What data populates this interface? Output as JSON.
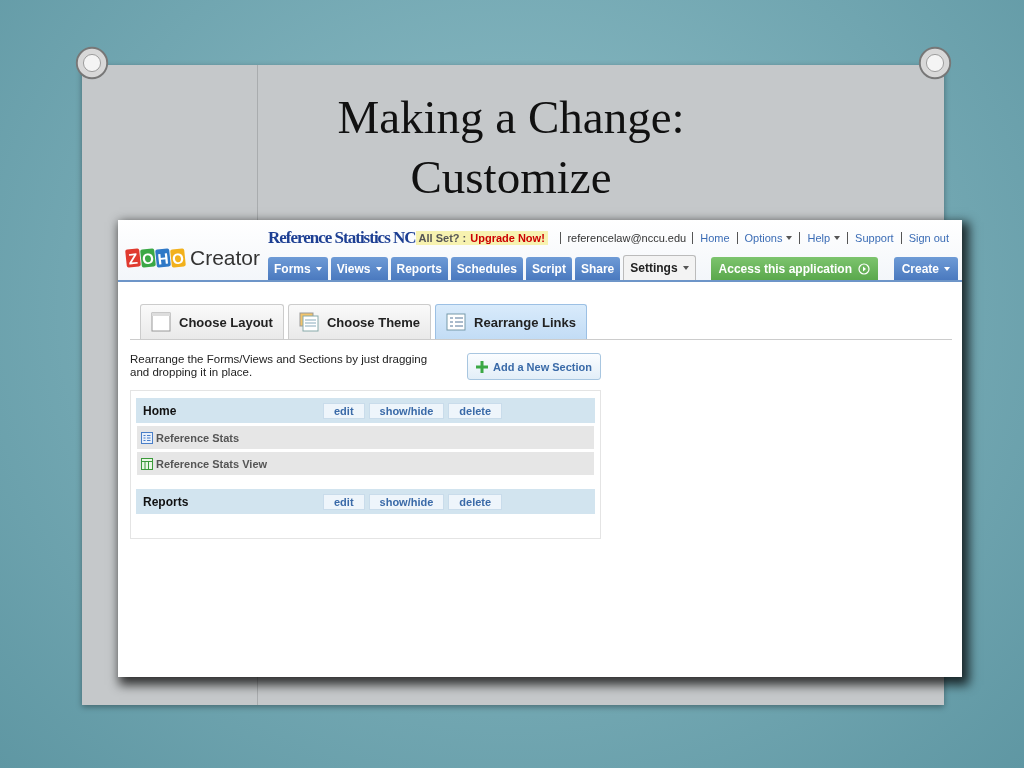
{
  "slide": {
    "title_lines": [
      "Making a Change:",
      "Customize"
    ]
  },
  "app": {
    "logo": {
      "letters": [
        {
          "char": "Z",
          "color": "#e03a2f"
        },
        {
          "char": "O",
          "color": "#3aa845"
        },
        {
          "char": "H",
          "color": "#2f79c7"
        },
        {
          "char": "O",
          "color": "#f2b11c"
        }
      ],
      "product": "Creator"
    },
    "app_title": "Reference Statistics NC",
    "upgrade_banner": {
      "prefix": "All Set? :",
      "link": "Upgrade Now!"
    },
    "account": "referencelaw@nccu.edu",
    "top_links": [
      {
        "label": "Home",
        "dropdown": false
      },
      {
        "label": "Options",
        "dropdown": true
      },
      {
        "label": "Help",
        "dropdown": true
      },
      {
        "label": "Support",
        "dropdown": false
      },
      {
        "label": "Sign out",
        "dropdown": false
      }
    ],
    "nav_tabs": [
      {
        "label": "Forms",
        "dropdown": true,
        "selected": false
      },
      {
        "label": "Views",
        "dropdown": true,
        "selected": false
      },
      {
        "label": "Reports",
        "dropdown": false,
        "selected": false
      },
      {
        "label": "Schedules",
        "dropdown": false,
        "selected": false
      },
      {
        "label": "Script",
        "dropdown": false,
        "selected": false
      },
      {
        "label": "Share",
        "dropdown": false,
        "selected": false
      },
      {
        "label": "Settings",
        "dropdown": true,
        "selected": true
      }
    ],
    "access_button": "Access this application",
    "create_button": "Create",
    "sub_tabs": [
      {
        "label": "Choose Layout",
        "kind": "layout",
        "selected": false
      },
      {
        "label": "Choose Theme",
        "kind": "theme",
        "selected": false
      },
      {
        "label": "Rearrange Links",
        "kind": "links",
        "selected": true
      }
    ],
    "instructions": "Rearrange the Forms/Views and Sections by just dragging and dropping it in place.",
    "add_section_button": "Add a New Section",
    "sections": [
      {
        "name": "Home",
        "actions": [
          "edit",
          "show/hide",
          "delete"
        ],
        "items": [
          {
            "label": "Reference Stats",
            "kind": "form"
          },
          {
            "label": "Reference Stats View",
            "kind": "view"
          }
        ]
      },
      {
        "name": "Reports",
        "actions": [
          "edit",
          "show/hide",
          "delete"
        ]
      }
    ]
  }
}
